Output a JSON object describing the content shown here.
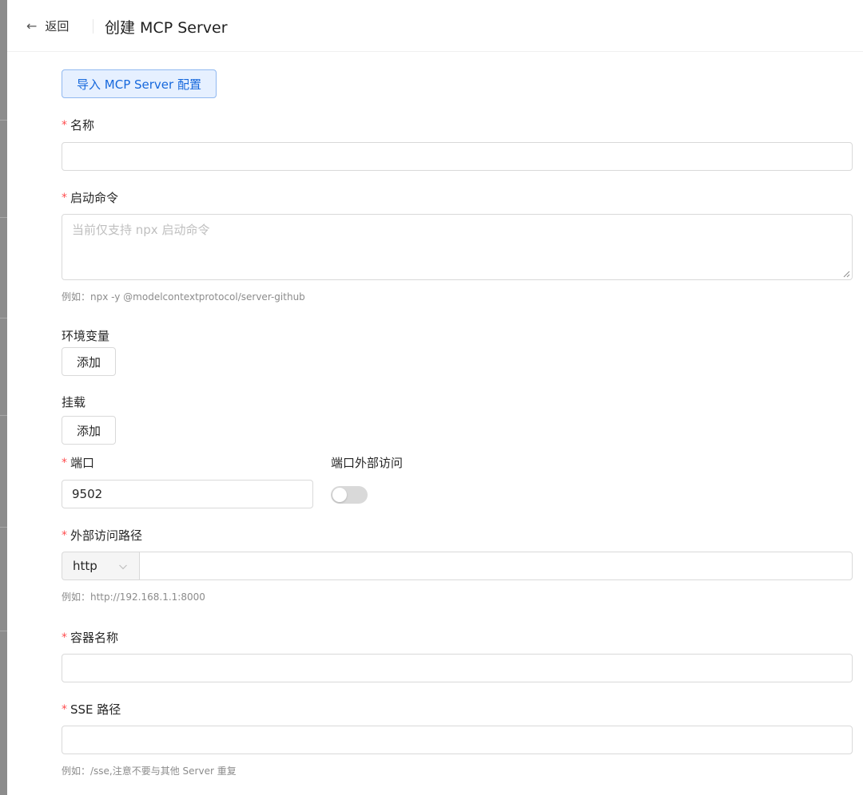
{
  "header": {
    "back_label": "返回",
    "title": "创建 MCP Server"
  },
  "import_button": "导入 MCP Server 配置",
  "form": {
    "name": {
      "label": "名称",
      "required_mark": "*",
      "value": ""
    },
    "command": {
      "label": "启动命令",
      "required_mark": "*",
      "placeholder": "当前仅支持 npx 启动命令",
      "hint": "例如：npx -y @modelcontextprotocol/server-github"
    },
    "env": {
      "label": "环境变量",
      "add_button": "添加"
    },
    "mount": {
      "label": "挂载",
      "add_button": "添加"
    },
    "port": {
      "label": "端口",
      "required_mark": "*",
      "value": "9502"
    },
    "port_external": {
      "label": "端口外部访问",
      "enabled": false
    },
    "external_path": {
      "label": "外部访问路径",
      "required_mark": "*",
      "protocol": "http",
      "value": "",
      "hint": "例如：http://192.168.1.1:8000"
    },
    "container_name": {
      "label": "容器名称",
      "required_mark": "*",
      "value": ""
    },
    "sse_path": {
      "label": "SSE 路径",
      "required_mark": "*",
      "value": "",
      "hint": "例如：/sse,注意不要与其他 Server 重复"
    }
  },
  "colors": {
    "primary": "#1668dc",
    "required": "#ff4d4f",
    "border": "#d9d9d9",
    "hint": "#8c8c8c"
  }
}
